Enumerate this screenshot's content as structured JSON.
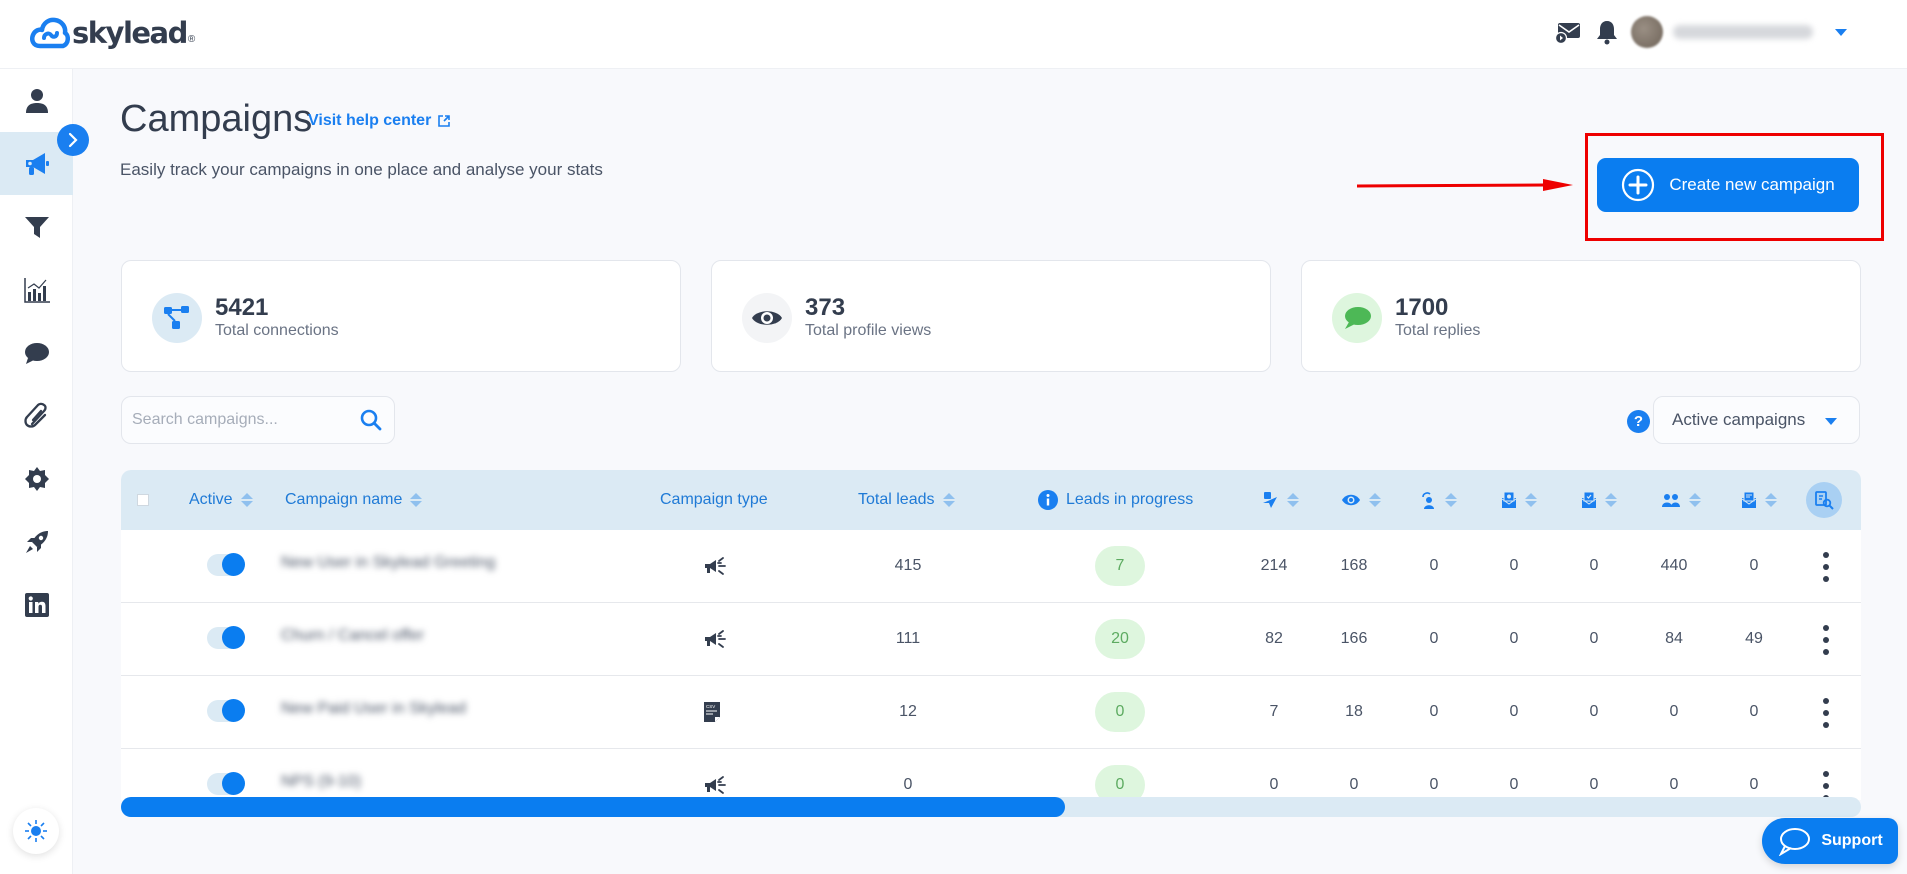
{
  "app": {
    "brand": "skylead",
    "brand_reg": "®",
    "accent_color": "#0a7df0"
  },
  "header": {
    "user_name": "Anja Aleksandjević",
    "icons": [
      "email-tracking-icon",
      "bell-icon",
      "avatar",
      "chevron-down-icon"
    ]
  },
  "sidebar": {
    "items": [
      {
        "name": "accounts",
        "icon": "user-icon",
        "active": false
      },
      {
        "name": "campaigns",
        "icon": "megaphone-icon",
        "active": true
      },
      {
        "name": "lead-filters",
        "icon": "funnel-icon",
        "active": false
      },
      {
        "name": "analytics",
        "icon": "chart-icon",
        "active": false
      },
      {
        "name": "inbox",
        "icon": "chat-icon",
        "active": false
      },
      {
        "name": "integrations",
        "icon": "paperclip-icon",
        "active": false
      },
      {
        "name": "settings",
        "icon": "gear-icon",
        "active": false
      },
      {
        "name": "onboarding",
        "icon": "rocket-icon",
        "active": false
      },
      {
        "name": "linkedin",
        "icon": "linkedin-icon",
        "active": false
      }
    ]
  },
  "page": {
    "title": "Campaigns",
    "help_link": "Visit help center",
    "subtitle": "Easily track your campaigns in one place and analyse your stats",
    "create_button": "Create new campaign"
  },
  "stats": [
    {
      "value": "5421",
      "label": "Total connections",
      "icon": "connections-icon"
    },
    {
      "value": "373",
      "label": "Total profile views",
      "icon": "eye-icon"
    },
    {
      "value": "1700",
      "label": "Total replies",
      "icon": "chat-bubble-icon"
    }
  ],
  "search": {
    "placeholder": "Search campaigns...",
    "value": ""
  },
  "filter": {
    "help": "?",
    "selected": "Active campaigns"
  },
  "table": {
    "columns": {
      "active": "Active",
      "name": "Campaign name",
      "type": "Campaign type",
      "total_leads": "Total leads",
      "in_progress": "Leads in progress"
    },
    "icon_columns": [
      "connection-sent-icon",
      "profile-view-icon",
      "follow-icon",
      "email-sent-icon",
      "email-verified-icon",
      "connections-accepted-icon",
      "email-replied-icon"
    ],
    "rows": [
      {
        "active": true,
        "name": "New User in Skylead Greeting",
        "type": "megaphone",
        "total_leads": "415",
        "in_progress": "7",
        "stats": [
          "214",
          "168",
          "0",
          "0",
          "0",
          "440",
          "0"
        ]
      },
      {
        "active": true,
        "name": "Churn / Cancel offer",
        "type": "megaphone",
        "total_leads": "111",
        "in_progress": "20",
        "stats": [
          "82",
          "166",
          "0",
          "0",
          "0",
          "84",
          "49"
        ]
      },
      {
        "active": true,
        "name": "New Paid User in Skylead",
        "type": "csv",
        "total_leads": "12",
        "in_progress": "0",
        "stats": [
          "7",
          "18",
          "0",
          "0",
          "0",
          "0",
          "0"
        ]
      },
      {
        "active": true,
        "name": "NPS (9-10)",
        "type": "megaphone",
        "total_leads": "0",
        "in_progress": "0",
        "stats": [
          "0",
          "0",
          "0",
          "0",
          "0",
          "0",
          "0"
        ]
      }
    ]
  },
  "scroll": {
    "horizontal_position_fraction": 0.0,
    "visible_fraction": 0.54
  },
  "support": {
    "label": "Support"
  }
}
